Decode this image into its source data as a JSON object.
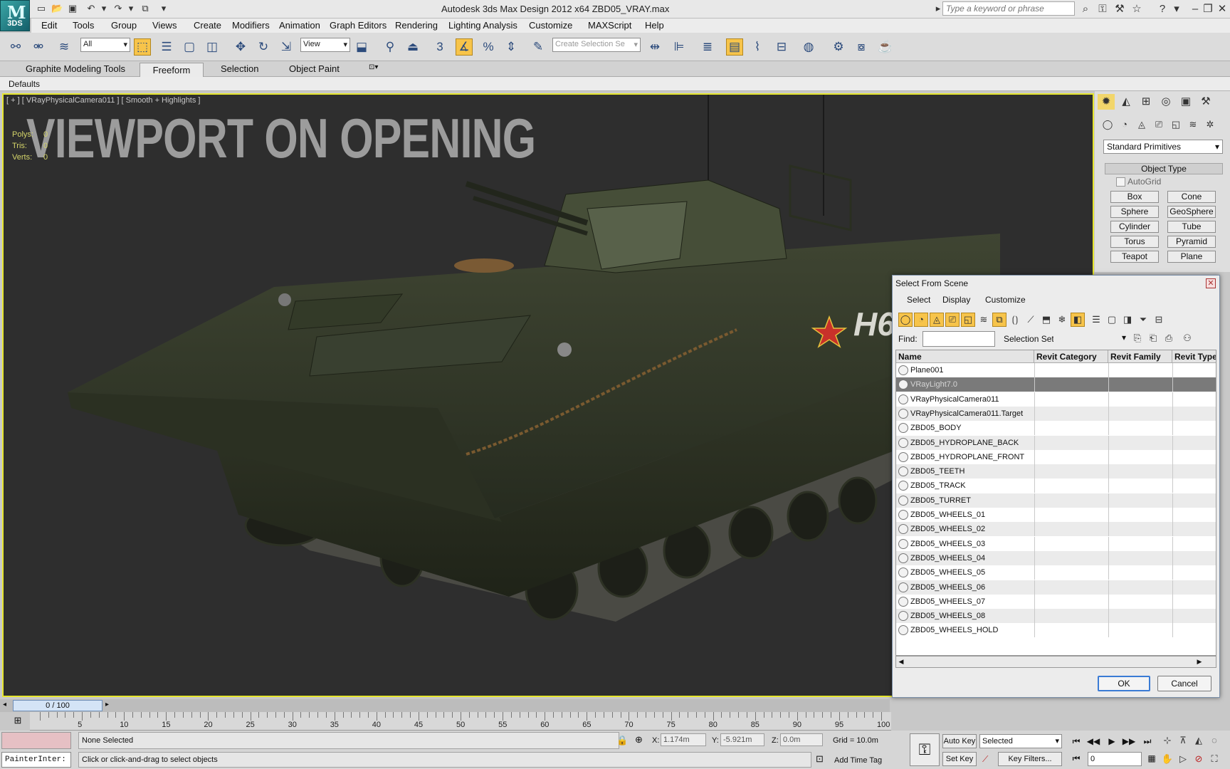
{
  "app": {
    "logo_text": "3DS",
    "title": "Autodesk 3ds Max Design 2012 x64      ZBD05_VRAY.max",
    "search_placeholder": "Type a keyword or phrase"
  },
  "quick_access": [
    "new-icon",
    "open-icon",
    "save-icon",
    "undo-icon",
    "redo-icon",
    "project-icon"
  ],
  "menu": [
    "Edit",
    "Tools",
    "Group",
    "Views",
    "Create",
    "Modifiers",
    "Animation",
    "Graph Editors",
    "Rendering",
    "Lighting Analysis",
    "Customize",
    "MAXScript",
    "Help"
  ],
  "toolbar": {
    "filter_value": "All",
    "refcoord_value": "View",
    "snap_label": "3",
    "selection_set_placeholder": "Create Selection Se"
  },
  "ribbon": {
    "tabs": [
      "Graphite Modeling Tools",
      "Freeform",
      "Selection",
      "Object Paint"
    ],
    "active_tab": "Freeform",
    "sub": "Defaults"
  },
  "viewport": {
    "label": "[ + ] [ VRayPhysicalCamera011 ] [ Smooth + Highlights ]",
    "overlay_heading": "VIEWPORT ON OPENING",
    "stats": [
      {
        "label": "Polys:",
        "value": "0"
      },
      {
        "label": "Tris:",
        "value": "0"
      },
      {
        "label": "Verts:",
        "value": "0"
      }
    ],
    "decal_text": "H6"
  },
  "command_panel": {
    "primitive_type": "Standard Primitives",
    "object_type_title": "Object Type",
    "autogrid": "AutoGrid",
    "primitives": [
      "Box",
      "Cone",
      "Sphere",
      "GeoSphere",
      "Cylinder",
      "Tube",
      "Torus",
      "Pyramid",
      "Teapot",
      "Plane"
    ]
  },
  "dialog": {
    "title": "Select From Scene",
    "menus": [
      "Select",
      "Display",
      "Customize"
    ],
    "find_label": "Find:",
    "selection_set_label": "Selection Set:",
    "columns": [
      "Name",
      "Revit Category",
      "Revit Family",
      "Revit Type"
    ],
    "rows": [
      {
        "name": "Plane001",
        "selected": false
      },
      {
        "name": "VRayLight7.0",
        "selected": true
      },
      {
        "name": "VRayPhysicalCamera011",
        "selected": false
      },
      {
        "name": "VRayPhysicalCamera011.Target",
        "selected": false
      },
      {
        "name": "ZBD05_BODY",
        "selected": false
      },
      {
        "name": "ZBD05_HYDROPLANE_BACK",
        "selected": false
      },
      {
        "name": "ZBD05_HYDROPLANE_FRONT",
        "selected": false
      },
      {
        "name": "ZBD05_TEETH",
        "selected": false
      },
      {
        "name": "ZBD05_TRACK",
        "selected": false
      },
      {
        "name": "ZBD05_TURRET",
        "selected": false
      },
      {
        "name": "ZBD05_WHEELS_01",
        "selected": false
      },
      {
        "name": "ZBD05_WHEELS_02",
        "selected": false
      },
      {
        "name": "ZBD05_WHEELS_03",
        "selected": false
      },
      {
        "name": "ZBD05_WHEELS_04",
        "selected": false
      },
      {
        "name": "ZBD05_WHEELS_05",
        "selected": false
      },
      {
        "name": "ZBD05_WHEELS_06",
        "selected": false
      },
      {
        "name": "ZBD05_WHEELS_07",
        "selected": false
      },
      {
        "name": "ZBD05_WHEELS_08",
        "selected": false
      },
      {
        "name": "ZBD05_WHEELS_HOLD",
        "selected": false
      }
    ],
    "ok": "OK",
    "cancel": "Cancel"
  },
  "timeline": {
    "slider_label": "0 / 100",
    "ticks": [
      "5",
      "10",
      "15",
      "20",
      "25",
      "30",
      "35",
      "40",
      "45",
      "50",
      "55",
      "60",
      "65",
      "70",
      "75",
      "80",
      "85",
      "90",
      "95",
      "100"
    ]
  },
  "status": {
    "script_listener": "PainterInter:",
    "selection": "None Selected",
    "hint": "Click or click-and-drag to select objects",
    "x_label": "X:",
    "x_value": "1.174m",
    "y_label": "Y:",
    "y_value": "-5.921m",
    "z_label": "Z:",
    "z_value": "0.0m",
    "grid": "Grid = 10.0m",
    "add_time_tag": "Add Time Tag",
    "auto_key": "Auto Key",
    "set_key": "Set Key",
    "key_mode": "Selected",
    "key_filters": "Key Filters...",
    "frame": "0"
  }
}
